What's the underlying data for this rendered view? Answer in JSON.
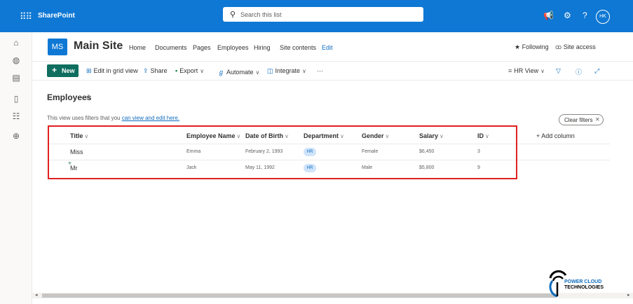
{
  "topbar": {
    "app_name": "SharePoint",
    "search_placeholder": "Search this list",
    "avatar_initials": "HK",
    "icons": [
      "waffle-icon",
      "megaphone-icon",
      "gear-icon",
      "help-icon"
    ]
  },
  "site": {
    "logo_text": "MS",
    "name": "Main Site",
    "nav": [
      "Home",
      "Documents",
      "Pages",
      "Employees",
      "Hiring",
      "Site contents"
    ],
    "edit_label": "Edit",
    "following_label": "Following",
    "site_access_label": "Site access"
  },
  "commandbar": {
    "new_label": "New",
    "edit_grid_label": "Edit in grid view",
    "share_label": "Share",
    "export_label": "Export",
    "automate_label": "Automate",
    "integrate_label": "Integrate",
    "more_label": "···",
    "view_label": "HR View"
  },
  "page": {
    "title": "Employees",
    "filter_text": "This view uses filters that you ",
    "filter_link": "can view and edit here.",
    "clear_filters_label": "Clear filters",
    "clear_filters_x": "✕"
  },
  "table": {
    "columns": [
      "Title",
      "Employee Name",
      "Date of Birth",
      "Department",
      "Gender",
      "Salary",
      "ID"
    ],
    "add_column_label": "+ Add column",
    "rows": [
      {
        "title": "Miss",
        "employee_name": "Emma",
        "date_of_birth": "February 2, 1993",
        "department": "HR",
        "gender": "Female",
        "salary": "$6,450",
        "id": "3"
      },
      {
        "title": "Mr",
        "employee_name": "Jack",
        "date_of_birth": "May 11, 1992",
        "department": "HR",
        "gender": "Male",
        "salary": "$5,800",
        "id": "9"
      }
    ]
  },
  "watermark": {
    "line1": "POWER CLOUD",
    "line2": "TECHNOLOGIES"
  },
  "colors": {
    "suite_bar": "#0f78d4",
    "new_button": "#0f6e5f",
    "highlight_box": "#e02020",
    "dept_pill": "#cfe4fa"
  }
}
